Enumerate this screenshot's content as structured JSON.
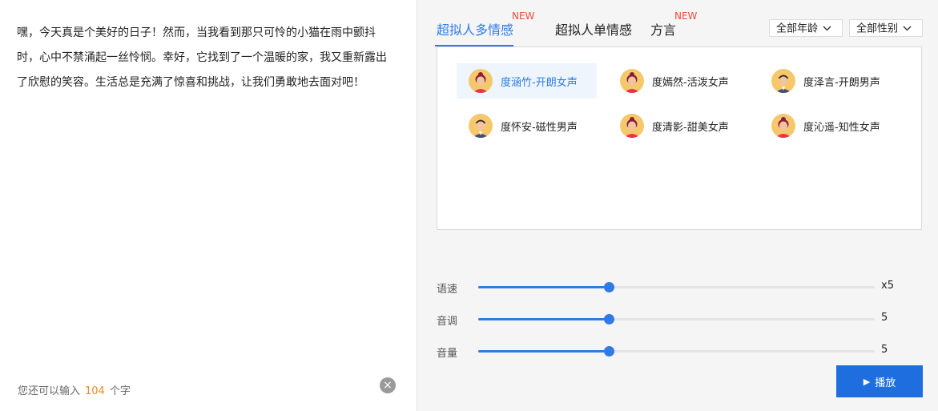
{
  "editor": {
    "text": "嘿，今天真是个美好的日子！然而，当我看到那只可怜的小猫在雨中颤抖\n时，心中不禁涌起一丝怜悯。幸好，它找到了一个温暖的家，我又重新露出\n了欣慰的笑容。生活总是充满了惊喜和挑战，让我们勇敢地去面对吧！",
    "counter_prefix": "您还可以输入",
    "counter_value": "104",
    "counter_suffix": "个字",
    "clear_icon": "×"
  },
  "tabs": [
    {
      "label": "超拟人多情感",
      "badge": "NEW",
      "active": true
    },
    {
      "label": "超拟人单情感",
      "badge": "",
      "active": false
    },
    {
      "label": "方言",
      "badge": "NEW",
      "active": false
    }
  ],
  "filters": {
    "age": "全部年龄",
    "gender": "全部性别",
    "chevron_icon": "chevron-down-icon"
  },
  "voices": [
    {
      "label": "度涵竹-开朗女声",
      "gender": "female",
      "selected": true
    },
    {
      "label": "度嫣然-活泼女声",
      "gender": "female",
      "selected": false
    },
    {
      "label": "度泽言-开朗男声",
      "gender": "male",
      "selected": false
    },
    {
      "label": "度怀安-磁性男声",
      "gender": "male",
      "selected": false
    },
    {
      "label": "度清影-甜美女声",
      "gender": "female",
      "selected": false
    },
    {
      "label": "度沁遥-知性女声",
      "gender": "female",
      "selected": false
    }
  ],
  "sliders": [
    {
      "label": "语速",
      "value_text": "x5",
      "fraction": 0.33
    },
    {
      "label": "音调",
      "value_text": "5",
      "fraction": 0.33
    },
    {
      "label": "音量",
      "value_text": "5",
      "fraction": 0.33
    }
  ],
  "play": {
    "label": "播放",
    "icon": "▶"
  },
  "colors": {
    "accent": "#2f7be6",
    "badge": "#f04a3c",
    "counter": "#f08a24",
    "play": "#1f6ee0"
  }
}
